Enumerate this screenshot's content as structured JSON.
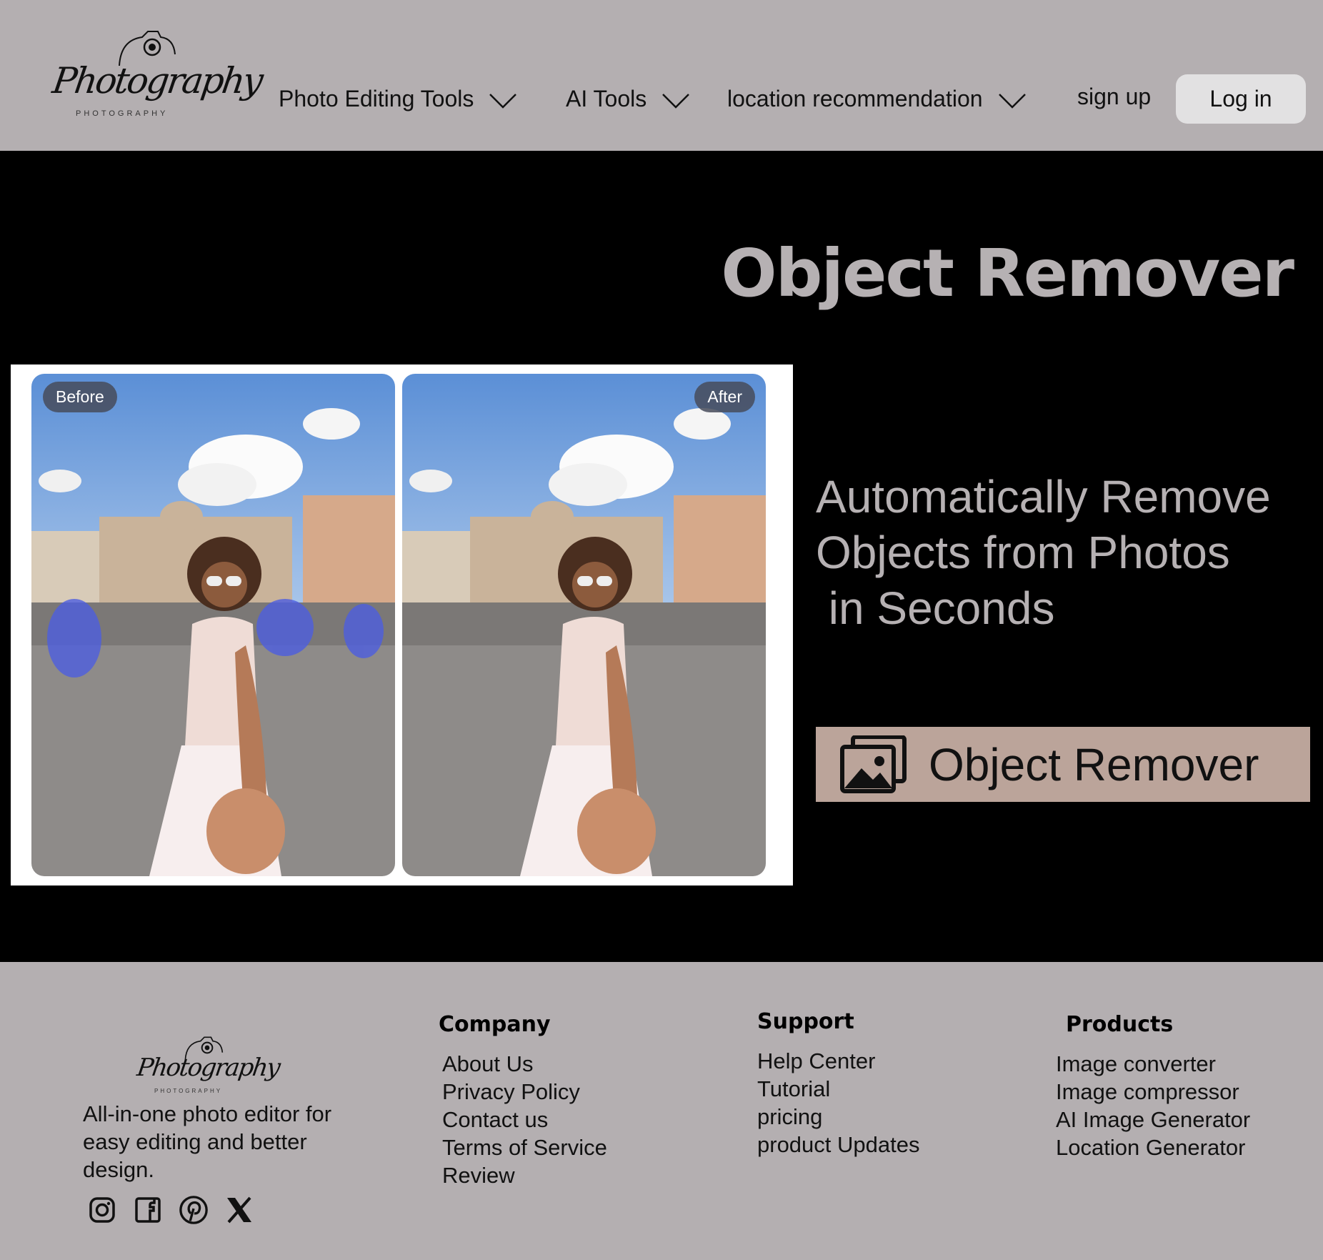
{
  "header": {
    "logo_text": "Photography",
    "logo_subtext": "PHOTOGRAPHY",
    "nav": [
      {
        "label": "Photo Editing Tools"
      },
      {
        "label": "AI Tools"
      },
      {
        "label": "location recommendation"
      }
    ],
    "signup_label": "sign up",
    "login_label": "Log in"
  },
  "hero": {
    "title": "Object Remover",
    "before_label": "Before",
    "after_label": "After",
    "subtitle_lines": [
      "Automatically Remove",
      "Objects from Photos",
      " in Seconds"
    ],
    "cta_label": "Object Remover",
    "cta_icon": "images-icon",
    "accent_color": "#bba49a",
    "title_color": "#b6b1b3"
  },
  "footer": {
    "logo_text": "Photography",
    "logo_subtext": "PHOTOGRAPHY",
    "tagline": "All-in-one photo editor for easy editing and better design.",
    "social": [
      "instagram-icon",
      "facebook-icon",
      "pinterest-icon",
      "x-icon"
    ],
    "columns": [
      {
        "title": "Company",
        "links": [
          "About Us",
          "Privacy Policy",
          "Contact us",
          "Terms of Service",
          "Review"
        ]
      },
      {
        "title": "Support",
        "links": [
          "Help Center",
          "Tutorial",
          "pricing",
          "product Updates"
        ]
      },
      {
        "title": "Products",
        "links": [
          "Image converter",
          "Image compressor",
          "AI Image Generator",
          "Location Generator"
        ]
      }
    ]
  }
}
